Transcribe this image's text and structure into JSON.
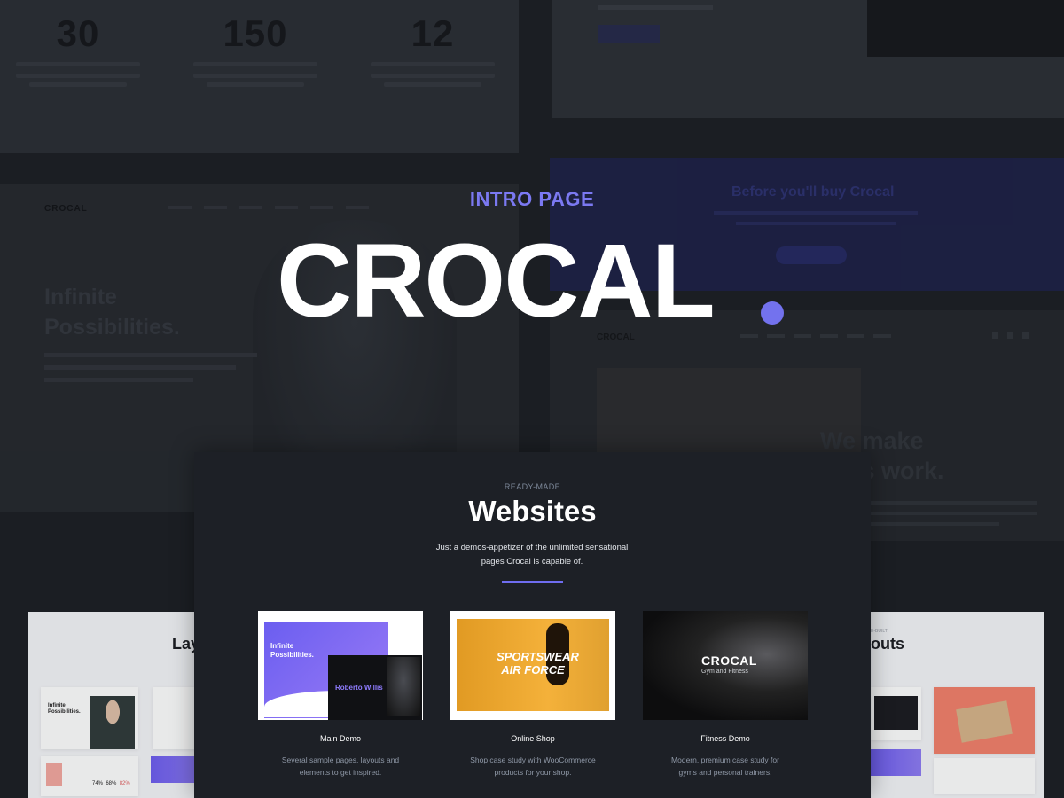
{
  "hero": {
    "eyebrow": "INTRO PAGE",
    "title": "CROCAL",
    "accent_color": "#7372ee"
  },
  "background": {
    "stats": [
      {
        "number": "30"
      },
      {
        "number": "150"
      },
      {
        "number": "12"
      }
    ],
    "left_logo": "CROCAL",
    "left_heading_line1": "Infinite",
    "left_heading_line2": "Possibilities.",
    "promo_title": "Before you'll buy Crocal",
    "right_logo": "CROCAL",
    "right_heading_line1": "We make",
    "right_heading_line2": "gs work.",
    "left_layouts_heading": "Lay",
    "right_layouts_heading": "outs",
    "right_layouts_eyebrow": "E-BUILT"
  },
  "section": {
    "eyebrow": "READY-MADE",
    "title": "Websites",
    "description": "Just a demos-appetizer of the unlimited sensational pages Crocal is capable of.",
    "divider_color": "#6f6df0"
  },
  "demos": [
    {
      "name": "Main Demo",
      "description": "Several sample pages, layouts and elements to get inspired.",
      "thumb_text_1": "Infinite Possibilities.",
      "thumb_text_2": "Roberto Willis"
    },
    {
      "name": "Online Shop",
      "description": "Shop case study with WooCommerce products for your shop.",
      "thumb_text_1": "SPORTSWEAR AIR FORCE"
    },
    {
      "name": "Fitness Demo",
      "description": "Modern, premium case study for gyms and personal trainers.",
      "thumb_text_1": "CROCAL",
      "thumb_text_2": "Gym and Fitness"
    }
  ]
}
